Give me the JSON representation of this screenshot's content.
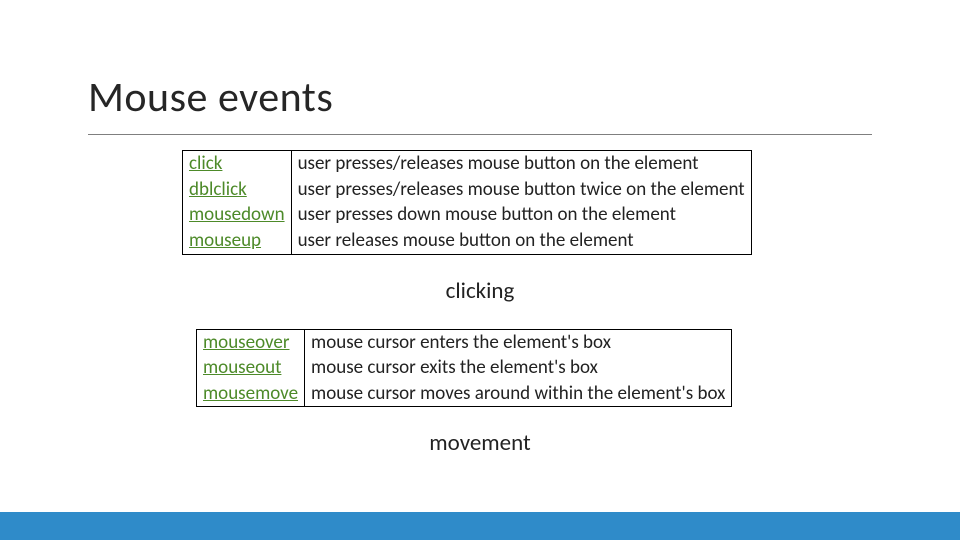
{
  "title": "Mouse events",
  "tables": [
    {
      "rows": [
        {
          "event": "click",
          "desc": "user presses/releases mouse button on the element"
        },
        {
          "event": "dblclick",
          "desc": "user presses/releases mouse button twice on the element"
        },
        {
          "event": "mousedown",
          "desc": "user presses down mouse button on the element"
        },
        {
          "event": "mouseup",
          "desc": "user releases mouse button on the element"
        }
      ],
      "caption": "clicking"
    },
    {
      "rows": [
        {
          "event": "mouseover",
          "desc": "mouse cursor enters the element's box"
        },
        {
          "event": "mouseout",
          "desc": "mouse cursor exits the element's box"
        },
        {
          "event": "mousemove",
          "desc": "mouse cursor moves around within the element's box"
        }
      ],
      "caption": "movement"
    }
  ]
}
